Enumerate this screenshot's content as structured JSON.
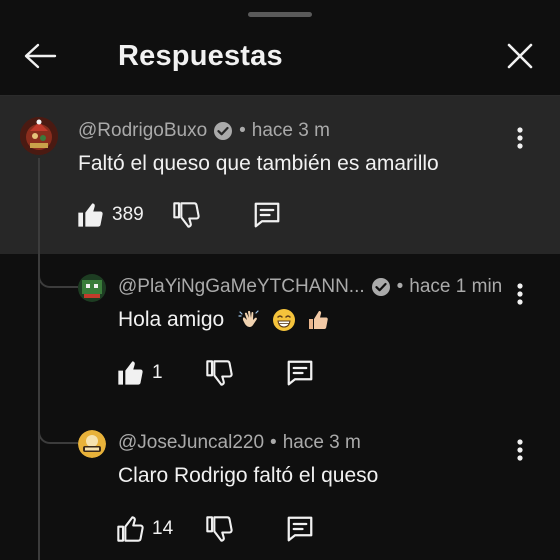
{
  "header": {
    "title": "Respuestas"
  },
  "parent": {
    "author": "@RodrigoBuxo",
    "time": "hace 3 m",
    "text": "Faltó el queso que también es amarillo",
    "likes": "389"
  },
  "replies": [
    {
      "author": "@PlaYiNgGaMeYTCHANN...",
      "time": "hace 1 min",
      "text": "Hola amigo",
      "likes": "1"
    },
    {
      "author": "@JoseJuncal220",
      "time": "hace 3 m",
      "text": "Claro Rodrigo faltó el queso",
      "likes": "14"
    }
  ],
  "colors": {
    "background": "#0f0f0f",
    "highlight": "#272727",
    "secondary_text": "#aaaaaa"
  }
}
